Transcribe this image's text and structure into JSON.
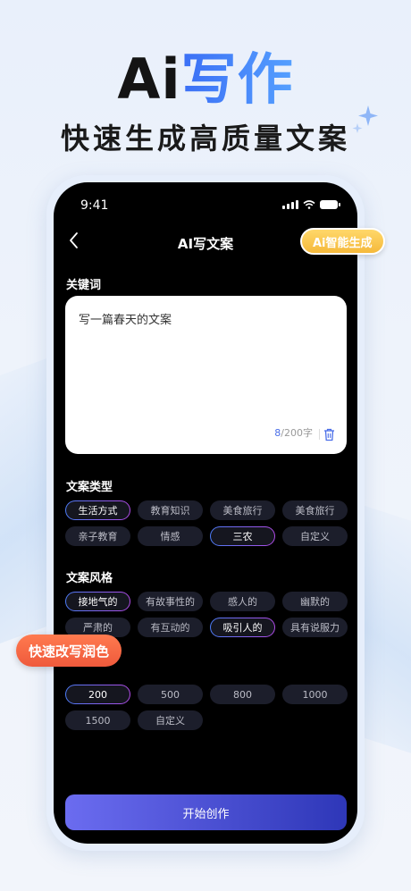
{
  "hero": {
    "title_black": "Ai",
    "title_blue": "写作",
    "subtitle": "快速生成高质量文案"
  },
  "status": {
    "time": "9:41"
  },
  "nav": {
    "title": "AI写文案"
  },
  "keyword": {
    "label": "关键词",
    "value": "写一篇春天的文案",
    "count_current": "8",
    "count_max": "/200字"
  },
  "type": {
    "label": "文案类型",
    "chips": [
      {
        "label": "生活方式",
        "selected": true
      },
      {
        "label": "教育知识",
        "selected": false
      },
      {
        "label": "美食旅行",
        "selected": false
      },
      {
        "label": "美食旅行",
        "selected": false
      },
      {
        "label": "亲子教育",
        "selected": false
      },
      {
        "label": "情感",
        "selected": false
      },
      {
        "label": "三农",
        "selected": true
      },
      {
        "label": "自定义",
        "selected": false
      }
    ]
  },
  "style": {
    "label": "文案风格",
    "chips": [
      {
        "label": "接地气的",
        "selected": true
      },
      {
        "label": "有故事性的",
        "selected": false
      },
      {
        "label": "感人的",
        "selected": false
      },
      {
        "label": "幽默的",
        "selected": false
      },
      {
        "label": "严肃的",
        "selected": false
      },
      {
        "label": "有互动的",
        "selected": false
      },
      {
        "label": "吸引人的",
        "selected": true
      },
      {
        "label": "具有说服力",
        "selected": false
      }
    ]
  },
  "length": {
    "chips": [
      {
        "label": "200",
        "selected": true
      },
      {
        "label": "500",
        "selected": false
      },
      {
        "label": "800",
        "selected": false
      },
      {
        "label": "1000",
        "selected": false
      },
      {
        "label": "1500",
        "selected": false
      },
      {
        "label": "自定义",
        "selected": false
      }
    ]
  },
  "start_button": "开始创作",
  "badges": {
    "ai": "Ai智能生成",
    "fast": "快速改写润色"
  },
  "colors": {
    "accent_blue": "#4a6ee8",
    "button_start": "#6b6cf0",
    "button_end": "#2e37b8",
    "badge_yellow": "#f5b93b",
    "badge_orange": "#ef5a3c"
  }
}
